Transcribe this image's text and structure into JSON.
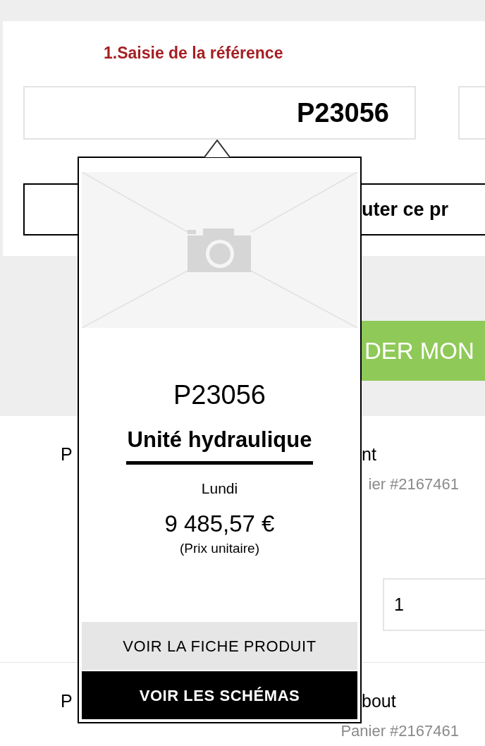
{
  "reference_panel": {
    "title": "1.Saisie de la référence",
    "reference_field": {
      "value": "P23056"
    },
    "add_button": {
      "label": "uter ce pr"
    }
  },
  "order_button": {
    "label": "DER MON"
  },
  "cart_rows": [
    {
      "column_1": "P",
      "column_2": "nt",
      "cart": "ier #2167461",
      "quantity": "1"
    },
    {
      "column_1": "P",
      "column_2": "bout",
      "cart": "Panier #2167461"
    }
  ],
  "popover": {
    "reference": "P23056",
    "name": "Unité hydraulique",
    "day": "Lundi",
    "price": "9 485,57 €",
    "price_note": "(Prix unitaire)",
    "buttons": [
      {
        "label": "VOIR LA FICHE PRODUIT",
        "kind": "secondary"
      },
      {
        "label": "VOIR LES SCHÉMAS",
        "kind": "primary"
      }
    ]
  }
}
